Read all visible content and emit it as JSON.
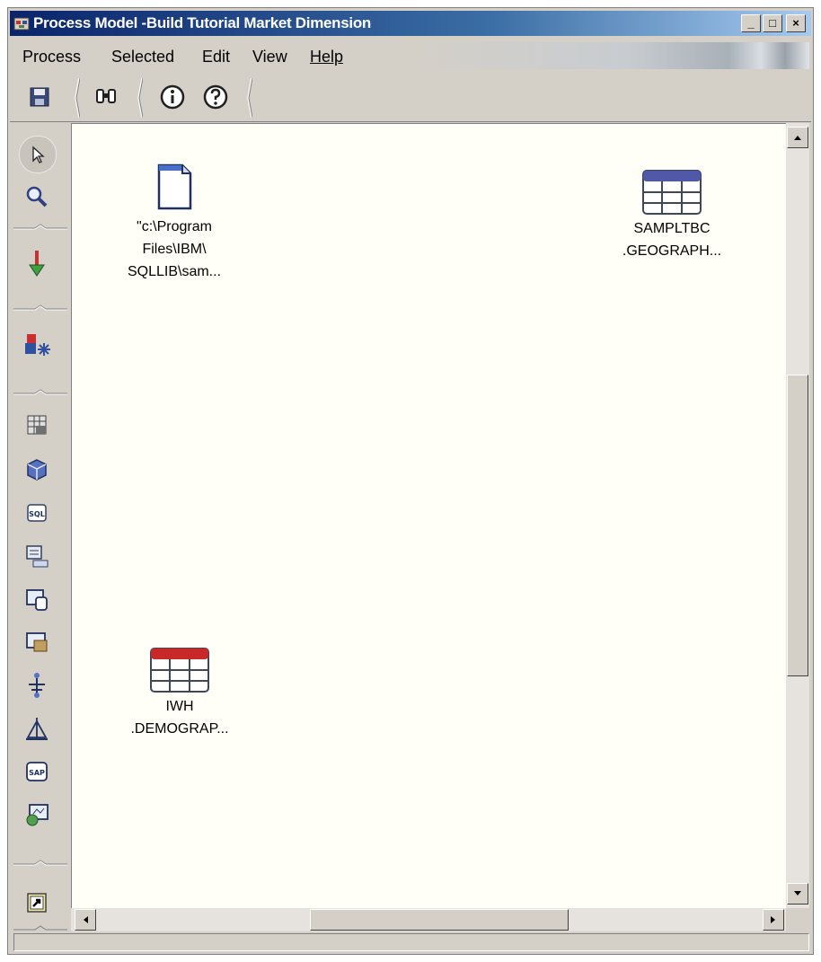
{
  "window": {
    "title": "Process Model -Build Tutorial Market Dimension",
    "controls": {
      "minimize": "_",
      "maximize": "□",
      "close": "×"
    }
  },
  "menubar": {
    "items": [
      {
        "label": "Process"
      },
      {
        "label": "Selected"
      },
      {
        "label": "Edit"
      },
      {
        "label": "View"
      },
      {
        "label": "Help"
      }
    ]
  },
  "toolbar": {
    "icons": [
      "save-icon",
      "find-binoculars-icon",
      "info-icon",
      "help-icon"
    ]
  },
  "palette": {
    "icons": [
      "select-pointer-icon",
      "zoom-icon",
      "link-arrow-icon",
      "task-flow-icon",
      "tables-icon",
      "cube-icon",
      "sql-icon",
      "transform-icon",
      "file-program-icon",
      "olap-icon",
      "tree-transform-icon",
      "statistics-icon",
      "sap-icon",
      "web-icon",
      "shortcut-icon"
    ]
  },
  "canvas": {
    "nodes": [
      {
        "label": "\"c:\\Program\nFiles\\IBM\\\nSQLLIB\\sam...",
        "icon": "file-icon"
      },
      {
        "label": "SAMPLTBC\n.GEOGRAPH...",
        "icon": "table-icon",
        "color": "#5058a8"
      },
      {
        "label": "IWH\n.DEMOGRAP...",
        "icon": "table-icon",
        "color": "#c82828"
      }
    ]
  },
  "scrollbars": {
    "vertical": {
      "thumb_start": 0.31,
      "thumb_end": 0.7
    },
    "horizontal": {
      "thumb_start": 0.34,
      "thumb_end": 0.72
    }
  },
  "statusbar": {
    "text": ""
  }
}
